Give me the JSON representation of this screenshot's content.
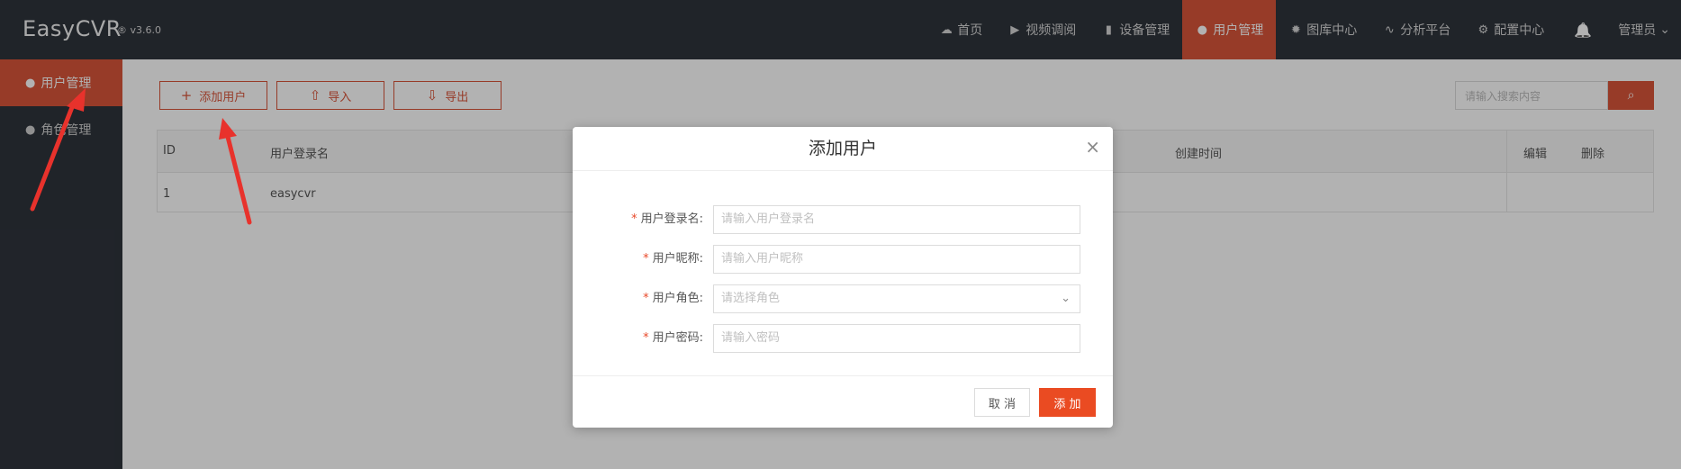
{
  "header": {
    "logo": "EasyCVR",
    "version": "® v3.6.0",
    "nav": [
      {
        "icon": "cloud-icon",
        "glyph": "☁",
        "label": "首页"
      },
      {
        "icon": "play-circle-icon",
        "glyph": "▶",
        "label": "视频调阅"
      },
      {
        "icon": "device-icon",
        "glyph": "▮",
        "label": "设备管理"
      },
      {
        "icon": "user-icon",
        "glyph": "●",
        "label": "用户管理"
      },
      {
        "icon": "image-library-icon",
        "glyph": "✹",
        "label": "图库中心"
      },
      {
        "icon": "pulse-icon",
        "glyph": "∿",
        "label": "分析平台"
      },
      {
        "icon": "gear-icon",
        "glyph": "⚙",
        "label": "配置中心"
      }
    ],
    "bell_glyph": "🔔",
    "admin_label": "管理员",
    "admin_chevron": "⌄"
  },
  "sidebar": {
    "items": [
      {
        "glyph": "●",
        "label": "用户管理"
      },
      {
        "glyph": "●",
        "label": "角色管理"
      }
    ]
  },
  "toolbar": {
    "add_user": {
      "glyph": "+",
      "label": "添加用户"
    },
    "import": {
      "glyph": "⇧",
      "label": "导入"
    },
    "export": {
      "glyph": "⇩",
      "label": "导出"
    },
    "search_placeholder": "请输入搜索内容",
    "search_glyph": "⌕"
  },
  "table": {
    "headers": {
      "id": "ID",
      "login": "用户登录名",
      "created": "创建时间",
      "edit": "编辑",
      "delete": "删除"
    },
    "rows": [
      {
        "id": "1",
        "login": "easycvr"
      }
    ]
  },
  "modal": {
    "title": "添加用户",
    "close_glyph": "×",
    "fields": [
      {
        "label": "用户登录名:",
        "placeholder": "请输入用户登录名"
      },
      {
        "label": "用户昵称:",
        "placeholder": "请输入用户昵称"
      },
      {
        "label": "用户角色:",
        "placeholder": "请选择角色"
      },
      {
        "label": "用户密码:",
        "placeholder": "请输入密码"
      }
    ],
    "required_mark": "*",
    "select_chevron": "⌄",
    "cancel_label": "取 消",
    "add_label": "添 加"
  },
  "colors": {
    "header_bg": "#2f343c",
    "accent": "#d9553a",
    "add_button": "#ea4b22",
    "annotation_arrow": "#e8322c"
  }
}
